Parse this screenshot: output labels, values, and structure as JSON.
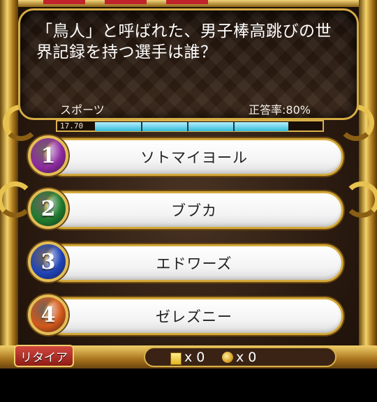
{
  "question": {
    "text": "「鳥人」と呼ばれた、男子棒高跳びの世界記録を持つ選手は誰？",
    "category": "スポーツ",
    "accuracy_label": "正答率:80%"
  },
  "timer": {
    "value": "17.70",
    "progress": 0.85
  },
  "answers": [
    {
      "number": "1",
      "label": "ソトマイヨール",
      "color": "#8e2aa0"
    },
    {
      "number": "2",
      "label": "ブブカ",
      "color": "#1f7a2e"
    },
    {
      "number": "3",
      "label": "エドワーズ",
      "color": "#1f43b8"
    },
    {
      "number": "4",
      "label": "ゼレズニー",
      "color": "#d2581a"
    }
  ],
  "bottom": {
    "retire_label": "リタイア",
    "card_count": "x 0",
    "coin_count": "x 0"
  },
  "colors": {
    "gold": "#d6ab43",
    "timer": "#2fb9d7"
  },
  "icons": [
    "card-icon",
    "coin-icon"
  ]
}
